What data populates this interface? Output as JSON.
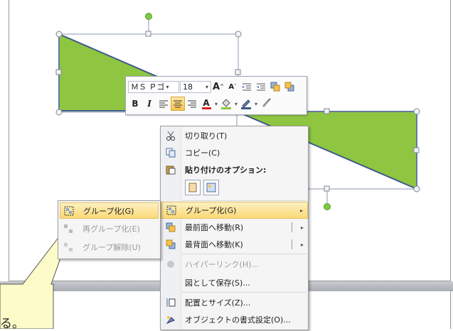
{
  "colors": {
    "shape_fill": "#8ec641",
    "shape_stroke": "#3f5a8c",
    "handle_green": "#7ccc40",
    "highlight": "#fad977",
    "callout_fill": "#fdfbc8"
  },
  "mini_toolbar": {
    "font_name": "ＭＳ Ｐゴ",
    "font_size": "18",
    "grow_font": "A",
    "shrink_font": "A",
    "bold": "B",
    "italic": "I"
  },
  "context_menu": {
    "cut": "切り取り(T)",
    "copy": "コピー(C)",
    "paste_options": "貼り付けのオプション:",
    "group": "グループ化(G)",
    "bring_front": "最前面へ移動(R)",
    "send_back": "最背面へ移動(K)",
    "hyperlink": "ハイパーリンク(H)...",
    "save_as_picture": "図として保存(S)...",
    "size_position": "配置とサイズ(Z)...",
    "format_object": "オブジェクトの書式設定(O)..."
  },
  "submenu": {
    "group": "グループ化(G)",
    "regroup": "再グループ化(E)",
    "ungroup": "グループ解除(U)"
  },
  "callout": {
    "text": "る。"
  }
}
